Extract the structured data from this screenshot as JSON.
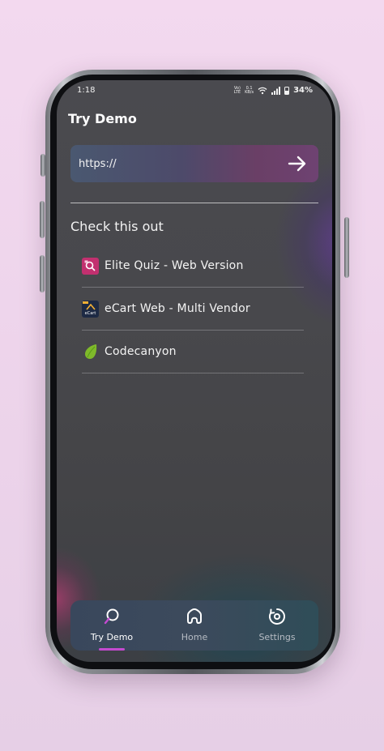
{
  "status_bar": {
    "time": "1:18",
    "network_top": "Vo)",
    "network_bottom": "LTE",
    "speed_top": "0.1",
    "speed_bottom": "KB/s",
    "battery_pct": "34%"
  },
  "header": {
    "title": "Try Demo"
  },
  "url_bar": {
    "value": "https://",
    "go_icon": "arrow-right-icon"
  },
  "section": {
    "heading": "Check this out"
  },
  "links": [
    {
      "label": "Elite Quiz - Web Version",
      "icon": "elite-quiz-icon"
    },
    {
      "label": "eCart Web - Multi Vendor",
      "icon": "ecart-icon",
      "icon_text": "eCart"
    },
    {
      "label": "Codecanyon",
      "icon": "codecanyon-icon"
    }
  ],
  "bottom_nav": [
    {
      "label": "Try Demo",
      "icon": "search-icon",
      "active": true
    },
    {
      "label": "Home",
      "icon": "home-icon",
      "active": false
    },
    {
      "label": "Settings",
      "icon": "settings-icon",
      "active": false
    }
  ],
  "colors": {
    "accent": "#c44ad0",
    "quiz_icon": "#c2306f",
    "codecanyon_icon": "#7fba2a"
  }
}
